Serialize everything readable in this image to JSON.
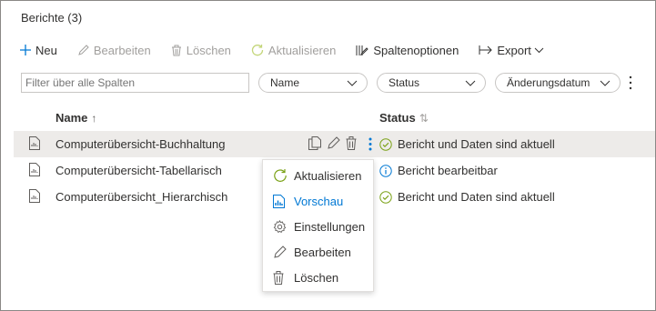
{
  "title": "Berichte (3)",
  "toolbar": {
    "new_label": "Neu",
    "edit_label": "Bearbeiten",
    "delete_label": "Löschen",
    "refresh_label": "Aktualisieren",
    "columns_label": "Spaltenoptionen",
    "export_label": "Export"
  },
  "filter": {
    "placeholder": "Filter über alle Spalten",
    "dropdowns": [
      "Name",
      "Status",
      "Änderungsdatum"
    ]
  },
  "columns": {
    "name": "Name",
    "name_sort": "↑",
    "status": "Status",
    "status_sort": "⇅"
  },
  "rows": [
    {
      "name": "Computerübersicht-Buchhaltung",
      "status": "Bericht und Daten sind aktuell",
      "status_icon": "check-circle-icon",
      "status_color": "#7aa116"
    },
    {
      "name": "Computerübersicht-Tabellarisch",
      "status": "Bericht bearbeitbar",
      "status_icon": "info-circle-icon",
      "status_color": "#0078d4"
    },
    {
      "name": "Computerübersicht_Hierarchisch",
      "status": "Bericht und Daten sind aktuell",
      "status_icon": "check-circle-icon",
      "status_color": "#7aa116"
    }
  ],
  "context_menu": {
    "items": [
      {
        "label": "Aktualisieren",
        "icon": "refresh-icon"
      },
      {
        "label": "Vorschau",
        "icon": "chart-icon"
      },
      {
        "label": "Einstellungen",
        "icon": "gear-icon"
      },
      {
        "label": "Bearbeiten",
        "icon": "pencil-icon"
      },
      {
        "label": "Löschen",
        "icon": "trash-icon"
      }
    ]
  },
  "colors": {
    "accent": "#0078d4",
    "success": "#7aa116",
    "selected_row": "#edebe9"
  }
}
